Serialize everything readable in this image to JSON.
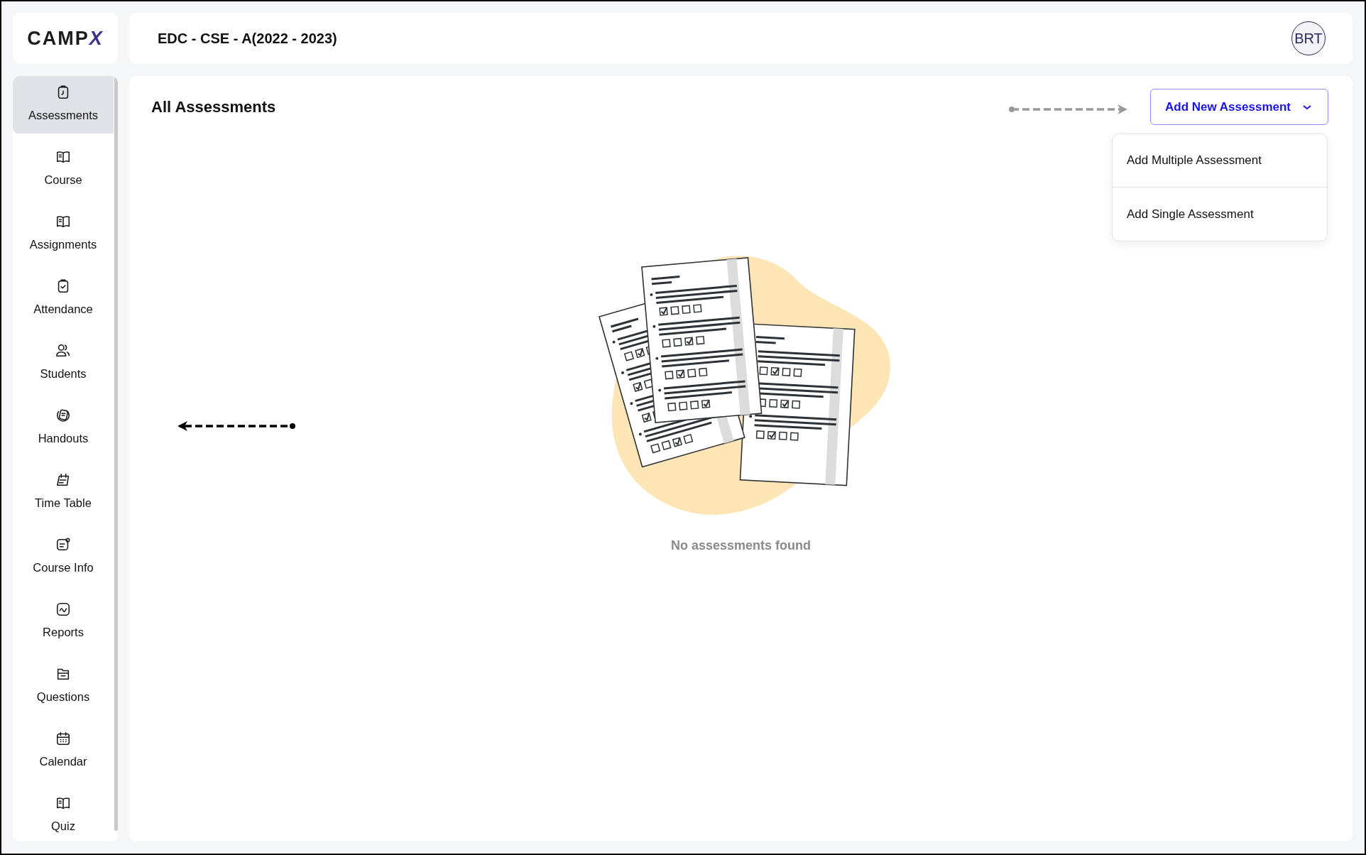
{
  "logo": {
    "main": "CAMP",
    "accent": "X"
  },
  "header": {
    "title": "EDC - CSE - A(2022 - 2023)",
    "avatar": "BRT"
  },
  "sidebar": {
    "items": [
      {
        "label": "Assessments",
        "selected": true
      },
      {
        "label": "Course",
        "selected": false
      },
      {
        "label": "Assignments",
        "selected": false
      },
      {
        "label": "Attendance",
        "selected": false
      },
      {
        "label": "Students",
        "selected": false
      },
      {
        "label": "Handouts",
        "selected": false
      },
      {
        "label": "Time Table",
        "selected": false
      },
      {
        "label": "Course Info",
        "selected": false
      },
      {
        "label": "Reports",
        "selected": false
      },
      {
        "label": "Questions",
        "selected": false
      },
      {
        "label": "Calendar",
        "selected": false
      },
      {
        "label": "Quiz",
        "selected": false
      }
    ]
  },
  "main": {
    "title": "All Assessments",
    "add_button": {
      "label": "Add New Assessment",
      "expanded": true
    },
    "menu": {
      "items": [
        "Add Multiple Assessment",
        "Add Single Assessment"
      ]
    },
    "empty_state": {
      "message": "No assessments found"
    }
  }
}
